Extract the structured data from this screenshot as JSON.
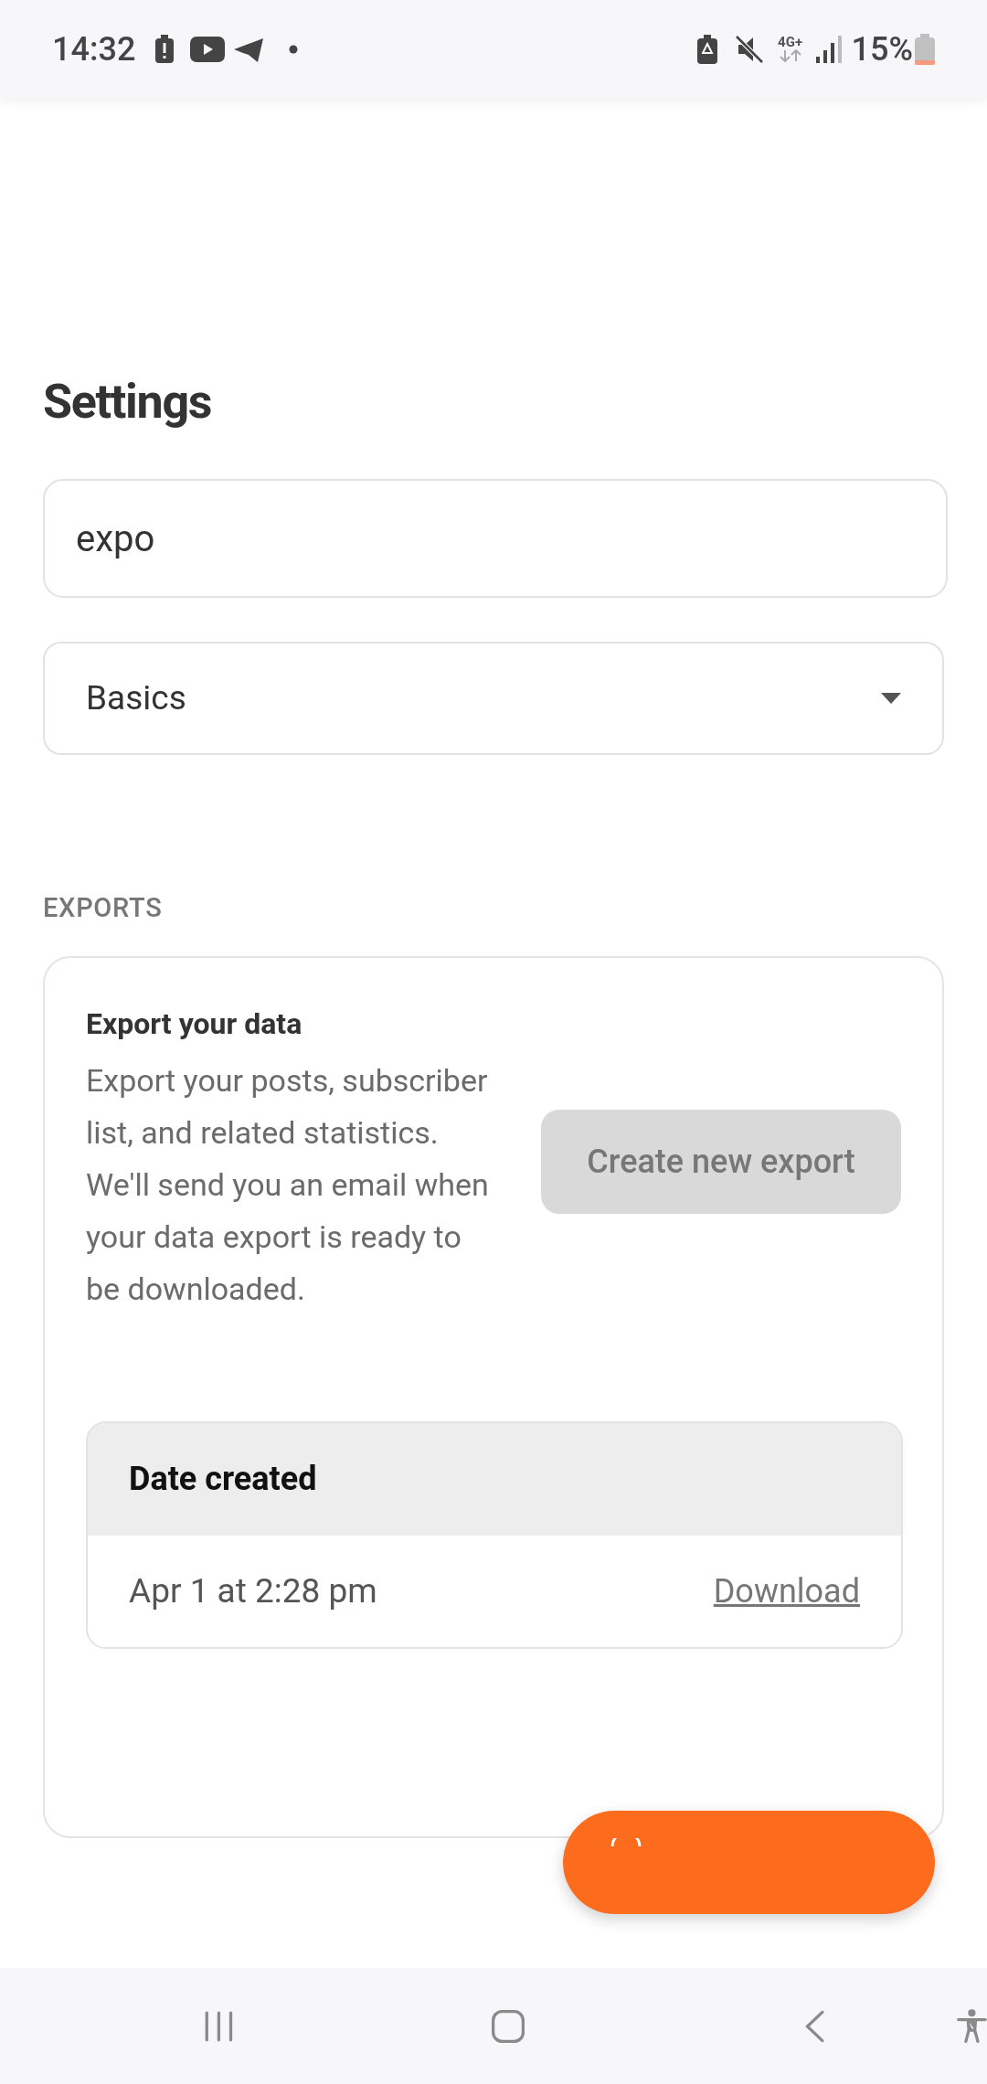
{
  "status_bar": {
    "time": "14:32",
    "network": "4G+",
    "battery": "15%"
  },
  "page": {
    "title": "Settings"
  },
  "search": {
    "value": "expo"
  },
  "category_select": {
    "value": "Basics"
  },
  "section": {
    "heading": "EXPORTS"
  },
  "export_card": {
    "title": "Export your data",
    "description": "Export your posts, subscriber list, and related statistics. We'll send you an email when your data export is ready to be downloaded.",
    "button": {
      "label": "Create new export",
      "disabled": true
    }
  },
  "exports_table": {
    "columns": [
      "Date created"
    ],
    "rows": [
      {
        "date": "Apr 1 at 2:28 pm",
        "action": "Download"
      }
    ]
  }
}
